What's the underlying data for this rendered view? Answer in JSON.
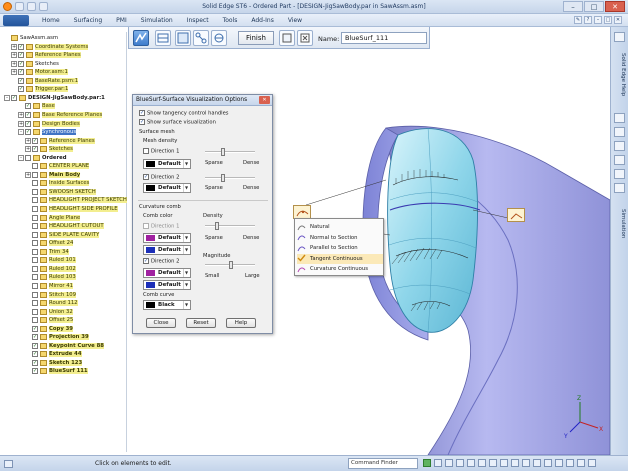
{
  "window": {
    "title": "Solid Edge ST6 - Ordered Part - [DESIGN-JigSawBody.par in SawAssm.asm]"
  },
  "ribbon": {
    "tabs": [
      "Home",
      "Surfacing",
      "PMI",
      "Simulation",
      "Inspect",
      "Tools",
      "Add-Ins",
      "View"
    ]
  },
  "commandbar": {
    "finish_label": "Finish",
    "name_label": "Name:",
    "name_value": "BlueSurf_111"
  },
  "tree": {
    "items": [
      {
        "label": "SawAssm.asm",
        "indent": 0,
        "exp": "",
        "style": "plain"
      },
      {
        "label": "Coordinate Systems",
        "indent": 1,
        "exp": "+",
        "style": "hl",
        "check": true
      },
      {
        "label": "Reference Planes",
        "indent": 1,
        "exp": "+",
        "style": "hl",
        "check": true
      },
      {
        "label": "Sketches",
        "indent": 1,
        "exp": "+",
        "style": "plain",
        "check": true
      },
      {
        "label": "Motor.asm:1",
        "indent": 1,
        "exp": "+",
        "style": "hl",
        "check": true
      },
      {
        "label": "BaseRate.psm:1",
        "indent": 1,
        "exp": "",
        "style": "hl",
        "check": true
      },
      {
        "label": "Trigger.par:1",
        "indent": 1,
        "exp": "",
        "style": "hl",
        "check": true
      },
      {
        "label": "DESIGN-JigSawBody.par:1",
        "indent": 0,
        "exp": "-",
        "style": "bold",
        "check": true
      },
      {
        "label": "Base",
        "indent": 2,
        "exp": "",
        "style": "hl",
        "check": true
      },
      {
        "label": "Base Reference Planes",
        "indent": 2,
        "exp": "+",
        "style": "hl",
        "check": true
      },
      {
        "label": "Design Bodies",
        "indent": 2,
        "exp": "+",
        "style": "hl",
        "check": true
      },
      {
        "label": "Synchronous",
        "indent": 2,
        "exp": "-",
        "style": "sel",
        "check": true
      },
      {
        "label": "Reference Planes",
        "indent": 3,
        "exp": "+",
        "style": "hl",
        "check": true
      },
      {
        "label": "Sketches",
        "indent": 3,
        "exp": "+",
        "style": "hl",
        "check": true
      },
      {
        "label": "Ordered",
        "indent": 2,
        "exp": "-",
        "style": "bold",
        "check": false
      },
      {
        "label": "CENTER PLANE",
        "indent": 3,
        "exp": "",
        "style": "hl",
        "check": false
      },
      {
        "label": "Main Body",
        "indent": 3,
        "exp": "+",
        "style": "hlbold",
        "check": false
      },
      {
        "label": "Inside Surfaces",
        "indent": 3,
        "exp": "",
        "style": "hl",
        "check": false
      },
      {
        "label": "SWOOSH SKETCH",
        "indent": 3,
        "exp": "",
        "style": "hl",
        "check": false
      },
      {
        "label": "HEADLIGHT PROJECT SKETCH",
        "indent": 3,
        "exp": "",
        "style": "hl",
        "check": false
      },
      {
        "label": "HEADLIGHT SIDE PROFILE",
        "indent": 3,
        "exp": "",
        "style": "hl",
        "check": false
      },
      {
        "label": "Angle Plane",
        "indent": 3,
        "exp": "",
        "style": "hl",
        "check": false
      },
      {
        "label": "HEADLIGHT CUTOUT",
        "indent": 3,
        "exp": "",
        "style": "hl",
        "check": false
      },
      {
        "label": "SIDE PLATE CAVITY",
        "indent": 3,
        "exp": "",
        "style": "hl",
        "check": false
      },
      {
        "label": "Offset 24",
        "indent": 3,
        "exp": "",
        "style": "hl",
        "check": false
      },
      {
        "label": "Trim 34",
        "indent": 3,
        "exp": "",
        "style": "hl",
        "check": false
      },
      {
        "label": "Ruled 101",
        "indent": 3,
        "exp": "",
        "style": "hl",
        "check": false
      },
      {
        "label": "Ruled 102",
        "indent": 3,
        "exp": "",
        "style": "hl",
        "check": false
      },
      {
        "label": "Ruled 103",
        "indent": 3,
        "exp": "",
        "style": "hl",
        "check": false
      },
      {
        "label": "Mirror 41",
        "indent": 3,
        "exp": "",
        "style": "hl",
        "check": false
      },
      {
        "label": "Stitch 109",
        "indent": 3,
        "exp": "",
        "style": "hl",
        "check": false
      },
      {
        "label": "Round 112",
        "indent": 3,
        "exp": "",
        "style": "hl",
        "check": false
      },
      {
        "label": "Union 32",
        "indent": 3,
        "exp": "",
        "style": "hl",
        "check": false
      },
      {
        "label": "Offset 25",
        "indent": 3,
        "exp": "",
        "style": "hl",
        "check": false
      },
      {
        "label": "Copy 39",
        "indent": 3,
        "exp": "",
        "style": "hlbold",
        "check": true
      },
      {
        "label": "Projection 39",
        "indent": 3,
        "exp": "",
        "style": "hlbold",
        "check": true
      },
      {
        "label": "Keypoint Curve 88",
        "indent": 3,
        "exp": "",
        "style": "hlbold",
        "check": true
      },
      {
        "label": "Extrude 44",
        "indent": 3,
        "exp": "",
        "style": "hlbold",
        "check": true
      },
      {
        "label": "Sketch 123",
        "indent": 3,
        "exp": "",
        "style": "hlbold",
        "check": true
      },
      {
        "label": "BlueSurf 111",
        "indent": 3,
        "exp": "",
        "style": "hlbold",
        "check": true
      }
    ]
  },
  "dialog": {
    "title": "BlueSurf-Surface Visualization Options",
    "show_tangency": "Show tangency control handles",
    "show_surface": "Show surface visualization",
    "surface_mesh": "Surface mesh",
    "mesh_density": "Mesh density",
    "direction1": "Direction 1",
    "direction2": "Direction 2",
    "sparse": "Sparse",
    "dense": "Dense",
    "default": "Default",
    "curvature_comb": "Curvature comb",
    "comb_color": "Comb color",
    "density": "Density",
    "magnitude": "Magnitude",
    "small": "Small",
    "large": "Large",
    "comb_curve": "Comb curve",
    "black": "Black",
    "close": "Close",
    "reset": "Reset",
    "help": "Help"
  },
  "popup": {
    "items": [
      "Natural",
      "Normal to Section",
      "Parallel to Section",
      "Tangent Continuous",
      "Curvature Continuous"
    ],
    "checked_index": 3
  },
  "dock": {
    "tab1": "Solid Edge Help",
    "tab2": "Simulation"
  },
  "status": {
    "message": "Click on elements to edit.",
    "command_finder": "Command Finder"
  },
  "colors": {
    "surface_light": "#8fd6ea",
    "surface_body": "#9fa4e6",
    "selection": "#3f73c4",
    "highlight": "#f3ee8f"
  },
  "icons": [
    "app-logo-icon",
    "save-icon",
    "undo-icon",
    "redo-icon",
    "minimize-icon",
    "maximize-icon",
    "close-icon",
    "tangency-icon",
    "curvature-icon",
    "natural-icon",
    "axis-triad-icon"
  ]
}
